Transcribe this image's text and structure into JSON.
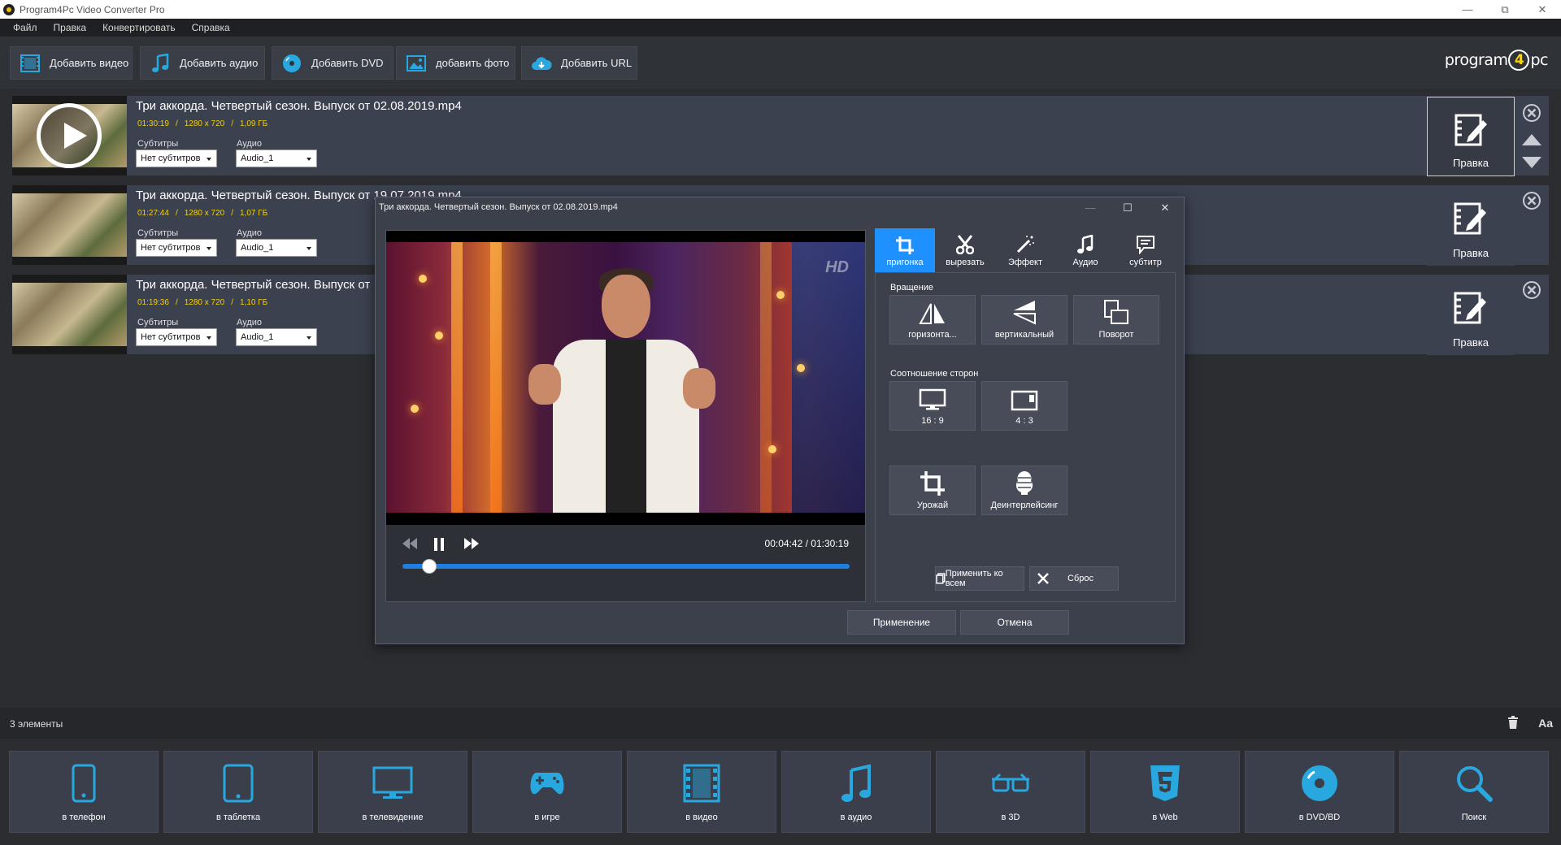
{
  "window": {
    "title": "Program4Pc Video Converter Pro"
  },
  "menu": [
    "Файл",
    "Правка",
    "Конвертировать",
    "Справка"
  ],
  "toolbar": {
    "add_video": "Добавить видео",
    "add_audio": "Добавить аудио",
    "add_dvd": "Добавить DVD",
    "add_photo": "добавить фото",
    "add_url": "Добавить URL"
  },
  "logo": {
    "left": "program",
    "digit": "4",
    "right": "pc"
  },
  "files": [
    {
      "name": "Три аккорда. Четвертый сезон. Выпуск от 02.08.2019.mp4",
      "duration": "01:30:19",
      "resolution": "1280 x 720",
      "size": "1,09 ГБ",
      "subtitles_label": "Субтитры",
      "subtitles_value": "Нет субтитров",
      "audio_label": "Аудио",
      "audio_value": "Audio_1",
      "edit_label": "Правка"
    },
    {
      "name": "Три аккорда. Четвертый сезон. Выпуск от 19.07.2019.mp4",
      "duration": "01:27:44",
      "resolution": "1280 x 720",
      "size": "1,07 ГБ",
      "subtitles_label": "Субтитры",
      "subtitles_value": "Нет субтитров",
      "audio_label": "Аудио",
      "audio_value": "Audio_1",
      "edit_label": "Правка"
    },
    {
      "name": "Три аккорда. Четвертый сезон. Выпуск от",
      "duration": "01:19:36",
      "resolution": "1280 x 720",
      "size": "1,10 ГБ",
      "subtitles_label": "Субтитры",
      "subtitles_value": "Нет субтитров",
      "audio_label": "Аудио",
      "audio_value": "Audio_1",
      "edit_label": "Правка"
    }
  ],
  "meta_sep": "/",
  "status": {
    "count": "3 элементы",
    "font_btn": "Aa"
  },
  "targets": [
    "в телефон",
    "в таблетка",
    "в телевидение",
    "в игре",
    "в видео",
    "в аудио",
    "в 3D",
    "в Web",
    "в DVD/BD",
    "Поиск"
  ],
  "dialog": {
    "title": "Три аккорда. Четвертый сезон. Выпуск от 02.08.2019.mp4",
    "watermark": "HD",
    "time_current": "00:04:42",
    "time_sep": "/",
    "time_total": "01:30:19",
    "progress": 0.06,
    "tabs": [
      "пригонка",
      "вырезать",
      "Эффект",
      "Аудио",
      "субтитр"
    ],
    "rotation_label": "Вращение",
    "rotation_buttons": [
      "горизонта...",
      "вертикальный",
      "Поворот"
    ],
    "aspect_label": "Соотношение сторон",
    "aspect_buttons": [
      "16 : 9",
      "4 : 3"
    ],
    "crop_label": "Урожай",
    "deinterlace_label": "Деинтерлейсинг",
    "apply_all": "Применить ко всем",
    "reset": "Сброс",
    "apply": "Применение",
    "cancel": "Отмена"
  },
  "colors": {
    "accent": "#1e90ff",
    "meta": "#f3d000",
    "row_bg": "#3c4150",
    "icon_blue": "#29a8e0"
  }
}
